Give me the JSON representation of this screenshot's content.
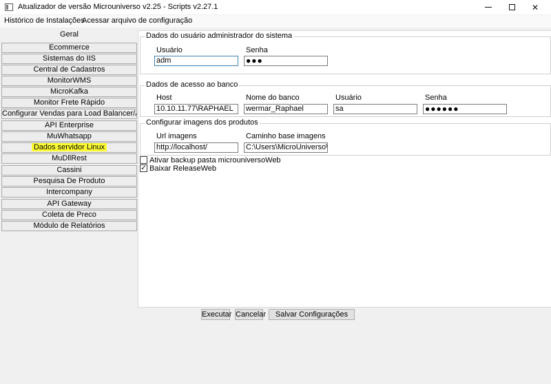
{
  "window": {
    "title": "Atualizador de versão Microuniverso v2.25 - Scripts v2.27.1",
    "icon": "app-window-icon",
    "controls": {
      "minimize_glyph": "minimize-icon",
      "maximize_glyph": "maximize-icon",
      "close_glyph": "✕"
    }
  },
  "menu": {
    "items": [
      "Histórico de Instalações",
      "Acessar arquivo de configuração"
    ]
  },
  "nav": {
    "items": [
      "Geral",
      "Ecommerce",
      "Sistemas do IIS",
      "Central de Cadastros",
      "MonitorWMS",
      "MicroKafka",
      "Monitor Frete Rápido",
      "Configurar Vendas para Load Balancer/AWS",
      "API Enterprise",
      "MuWhatsapp",
      "Dados servidor Linux",
      "MuDllRest",
      "Cassini",
      "Pesquisa De Produto",
      "Intercompany",
      "API Gateway",
      "Coleta de Preco",
      "Módulo de Relatórios"
    ],
    "active_index": 0,
    "highlighted_index": 10,
    "highlight_color": "#ffff33"
  },
  "admin_group": {
    "title": "Dados do usuário administrador do sistema",
    "user_label": "Usuário",
    "user_value": "adm",
    "password_label": "Senha",
    "password_value": "●●●"
  },
  "db_group": {
    "title": "Dados de acesso ao banco",
    "host_label": "Host",
    "host_value": "10.10.11.77\\RAPHAEL",
    "dbname_label": "Nome do banco",
    "dbname_value": "wermar_Raphael",
    "user_label": "Usuário",
    "user_value": "sa",
    "password_label": "Senha",
    "password_value": "●●●●●●"
  },
  "images_group": {
    "title": "Configurar imagens dos produtos",
    "url_label": "Url imagens",
    "url_value": "http://localhost/",
    "path_label": "Caminho base imagens",
    "path_value": "C:\\Users\\MicroUniverso\\Pict"
  },
  "options": {
    "backup_label": "Ativar backup pasta microuniversoWeb",
    "backup_checked": false,
    "release_label": "Baixar ReleaseWeb",
    "release_checked": true,
    "check_glyph": "✓"
  },
  "buttons": {
    "execute": "Executar",
    "cancel": "Cancelar",
    "save": "Salvar Configurações"
  }
}
